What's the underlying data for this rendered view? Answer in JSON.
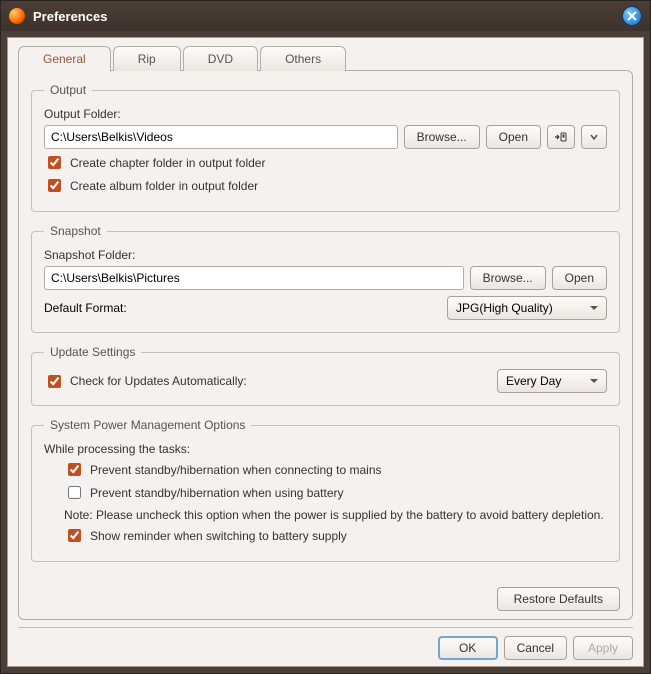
{
  "window": {
    "title": "Preferences"
  },
  "tabs": [
    "General",
    "Rip",
    "DVD",
    "Others"
  ],
  "active_tab": 0,
  "output": {
    "legend": "Output",
    "folder_label": "Output Folder:",
    "folder_value": "C:\\Users\\Belkis\\Videos",
    "browse": "Browse...",
    "open": "Open",
    "chapter_folder": "Create chapter folder in output folder",
    "album_folder": "Create album folder in output folder",
    "chapter_checked": true,
    "album_checked": true
  },
  "snapshot": {
    "legend": "Snapshot",
    "folder_label": "Snapshot Folder:",
    "folder_value": "C:\\Users\\Belkis\\Pictures",
    "browse": "Browse...",
    "open": "Open",
    "format_label": "Default Format:",
    "format_value": "JPG(High Quality)"
  },
  "updates": {
    "legend": "Update Settings",
    "check_label": "Check for Updates Automatically:",
    "check_checked": true,
    "interval": "Every Day"
  },
  "power": {
    "legend": "System Power Management Options",
    "while_label": "While processing the tasks:",
    "prevent_mains": "Prevent standby/hibernation when connecting to mains",
    "prevent_mains_checked": true,
    "prevent_battery": "Prevent standby/hibernation when using battery",
    "prevent_battery_checked": false,
    "note": "Note: Please uncheck this option when the power is supplied by the battery to avoid battery depletion.",
    "reminder": "Show reminder when switching to battery supply",
    "reminder_checked": true
  },
  "buttons": {
    "restore": "Restore Defaults",
    "ok": "OK",
    "cancel": "Cancel",
    "apply": "Apply"
  }
}
